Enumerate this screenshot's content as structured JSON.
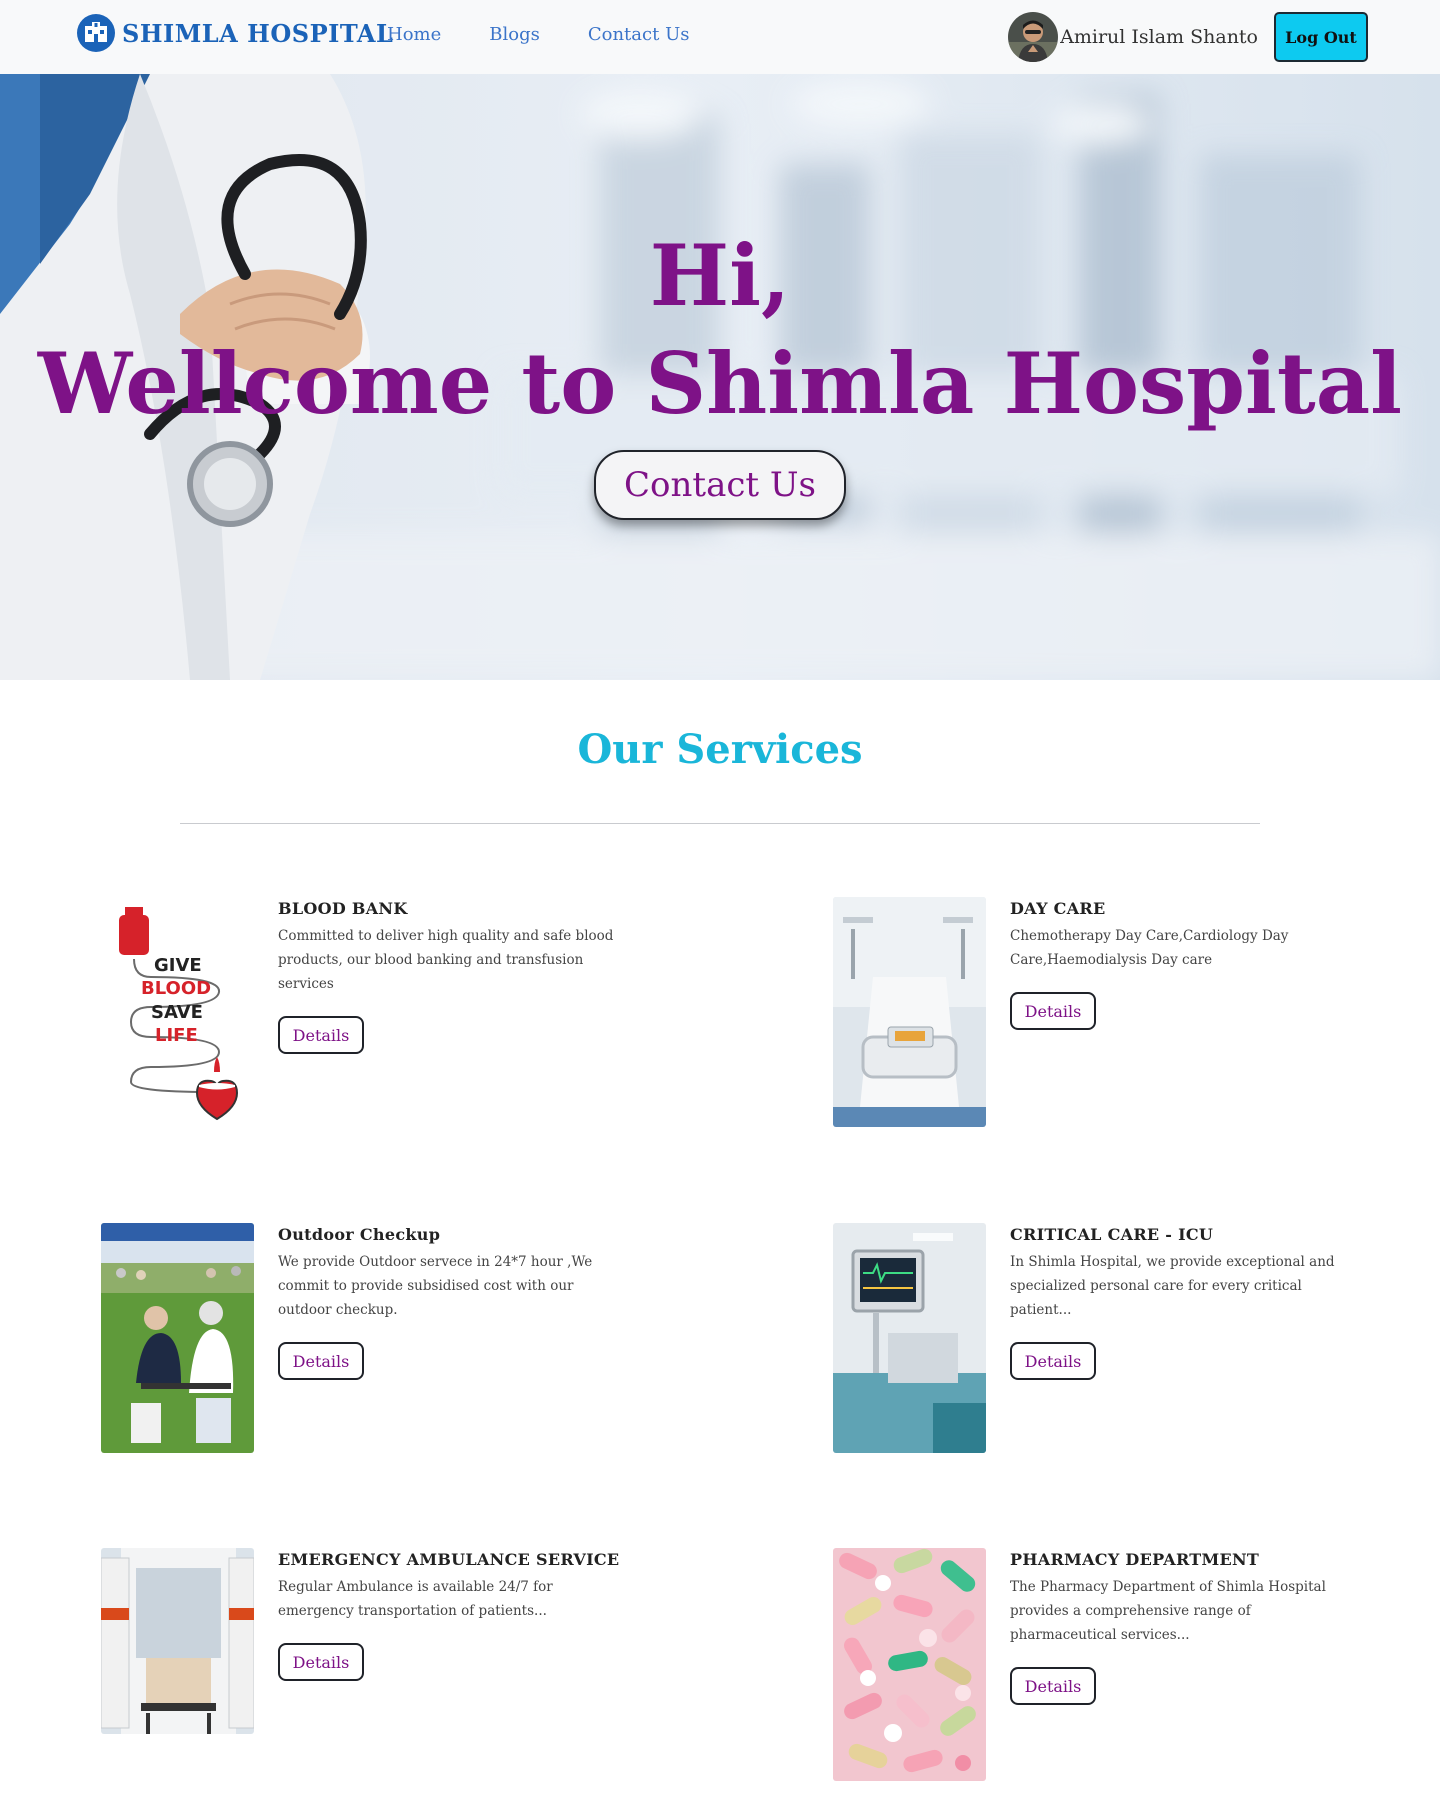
{
  "navbar": {
    "brand": "SHIMLA HOSPITAL",
    "links": [
      "Home",
      "Blogs",
      "Contact Us"
    ],
    "user_name": "Amirul Islam Shanto",
    "logout_label": "Log Out"
  },
  "hero": {
    "greeting": "Hi,",
    "headline": "Wellcome to Shimla Hospital",
    "contact_button": "Contact Us"
  },
  "services": {
    "title": "Our Services",
    "items": [
      {
        "title": "BLOOD BANK",
        "description": "Committed to deliver high quality and safe blood products, our blood banking and transfusion services",
        "button": "Details",
        "image_text": [
          "GIVE",
          "BLOOD",
          "SAVE",
          "LIFE"
        ]
      },
      {
        "title": "DAY CARE",
        "description": "Chemotherapy Day Care,Cardiology Day Care,Haemodialysis Day care",
        "button": "Details"
      },
      {
        "title": "Outdoor Checkup",
        "description": "We provide Outdoor servece in 24*7 hour ,We commit to provide subsidised cost with our outdoor checkup.",
        "button": "Details"
      },
      {
        "title": "CRITICAL CARE - ICU",
        "description": "In Shimla Hospital, we provide exceptional and specialized personal care for every critical patient...",
        "button": "Details"
      },
      {
        "title": "EMERGENCY AMBULANCE SERVICE",
        "description": "Regular Ambulance is available 24/7 for emergency transportation of patients...",
        "button": "Details"
      },
      {
        "title": "PHARMACY DEPARTMENT",
        "description": "The Pharmacy Department of Shimla Hospital provides a comprehensive range of pharmaceutical services...",
        "button": "Details"
      }
    ]
  },
  "colors": {
    "brand_blue": "#1b63b8",
    "nav_link": "#3b74c9",
    "hero_purple": "#7e1287",
    "services_cyan": "#1ab6d9",
    "logout_bg": "#0dcaf0"
  }
}
